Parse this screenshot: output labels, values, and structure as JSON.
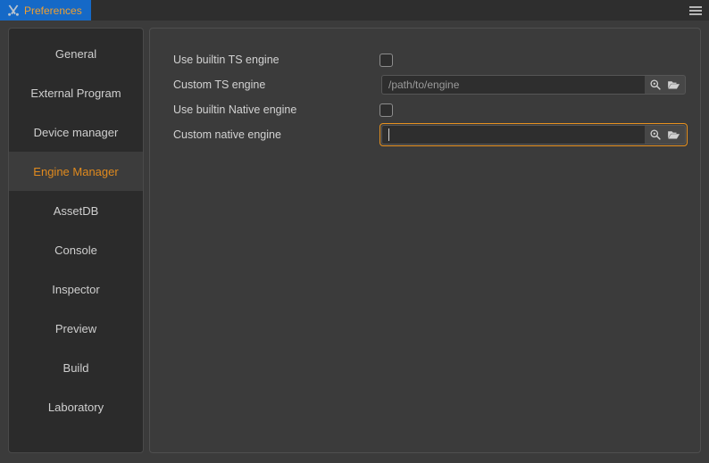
{
  "titlebar": {
    "tab": {
      "label": "Preferences",
      "icon": "tools-icon"
    },
    "menu_icon": "hamburger-menu-icon"
  },
  "sidebar": {
    "items": [
      {
        "label": "General",
        "active": false
      },
      {
        "label": "External Program",
        "active": false
      },
      {
        "label": "Device manager",
        "active": false
      },
      {
        "label": "Engine Manager",
        "active": true
      },
      {
        "label": "AssetDB",
        "active": false
      },
      {
        "label": "Console",
        "active": false
      },
      {
        "label": "Inspector",
        "active": false
      },
      {
        "label": "Preview",
        "active": false
      },
      {
        "label": "Build",
        "active": false
      },
      {
        "label": "Laboratory",
        "active": false
      }
    ]
  },
  "main": {
    "rows": [
      {
        "label": "Use builtin TS engine",
        "type": "checkbox",
        "checked": false
      },
      {
        "label": "Custom TS engine",
        "type": "path",
        "value": "",
        "placeholder": "/path/to/engine",
        "focused": false,
        "search_icon": "search-icon",
        "folder_icon": "folder-open-icon"
      },
      {
        "label": "Use builtin Native engine",
        "type": "checkbox",
        "checked": false
      },
      {
        "label": "Custom native engine",
        "type": "path",
        "value": "",
        "placeholder": "",
        "focused": true,
        "search_icon": "search-icon",
        "folder_icon": "folder-open-icon"
      }
    ]
  },
  "colors": {
    "tab_background": "#1569c7",
    "tab_text": "#f0a030",
    "accent_orange": "#e08a1e",
    "focus_border": "#e8921f",
    "window_background": "#3b3b3b",
    "sidebar_background": "#2b2b2b",
    "selected_item_background": "#3c3c3c",
    "input_background": "#2e2e2e"
  }
}
